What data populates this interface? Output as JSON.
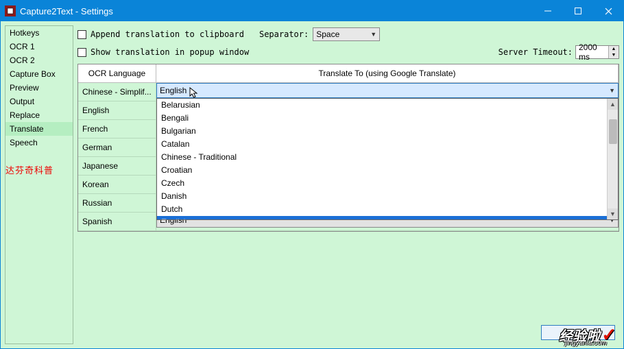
{
  "window": {
    "title": "Capture2Text - Settings"
  },
  "sidebar": {
    "items": [
      "Hotkeys",
      "OCR 1",
      "OCR 2",
      "Capture Box",
      "Preview",
      "Output",
      "Replace",
      "Translate",
      "Speech"
    ],
    "selected_index": 7,
    "watermark": "达芬奇科普"
  },
  "options": {
    "append_label": "Append translation to clipboard",
    "separator_label": "Separator:",
    "separator_value": "Space",
    "popup_label": "Show translation in popup window",
    "server_label": "Server Timeout:",
    "server_value": "2000 ms"
  },
  "table": {
    "head_ocr": "OCR Language",
    "head_translate": "Translate To (using Google Translate)",
    "rows": [
      {
        "ocr": "Chinese - Simplif...",
        "val": "English",
        "open": true
      },
      {
        "ocr": "English",
        "val": ""
      },
      {
        "ocr": "French",
        "val": ""
      },
      {
        "ocr": "German",
        "val": ""
      },
      {
        "ocr": "Japanese",
        "val": ""
      },
      {
        "ocr": "Korean",
        "val": ""
      },
      {
        "ocr": "Russian",
        "val": ""
      },
      {
        "ocr": "Spanish",
        "val": "English"
      }
    ]
  },
  "dropdown": {
    "items": [
      "Belarusian",
      "Bengali",
      "Bulgarian",
      "Catalan",
      "Chinese - Traditional",
      "Croatian",
      "Czech",
      "Danish",
      "Dutch",
      "English"
    ],
    "highlight_index": 9
  },
  "brand": {
    "cn": "经验啦",
    "url": "jingyanla.com"
  }
}
